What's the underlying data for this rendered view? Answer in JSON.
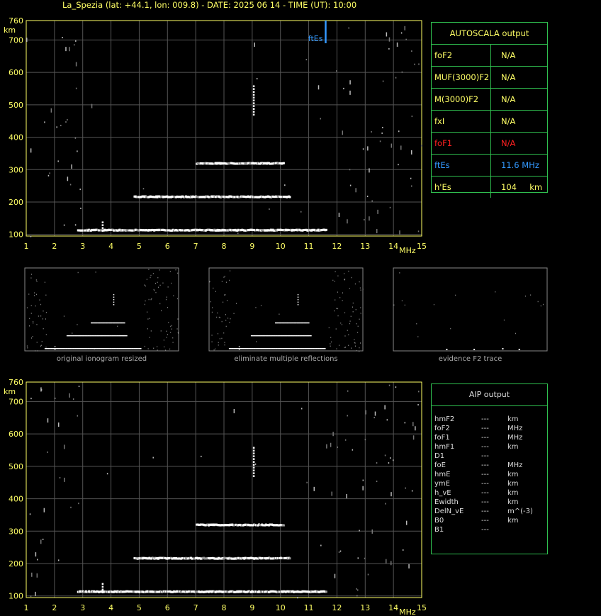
{
  "title": "La_Spezia (lat: +44.1, lon: 009.8) - DATE: 2025 06 14 - TIME (UT): 10:00",
  "colors": {
    "axis": "#ffff66",
    "grid": "#555555",
    "fEs": "#3399ff",
    "foF1": "#ff2020",
    "panel_border": "#2fbf4f"
  },
  "autoscala": {
    "header": "AUTOSCALA output",
    "rows": [
      {
        "key": "foF2",
        "value": "N/A",
        "color": "#ffff66"
      },
      {
        "key": "MUF(3000)F2",
        "value": "N/A",
        "color": "#ffff66"
      },
      {
        "key": "M(3000)F2",
        "value": "N/A",
        "color": "#ffff66"
      },
      {
        "key": "fxI",
        "value": "N/A",
        "color": "#ffff66"
      },
      {
        "key": "foF1",
        "value": "N/A",
        "color": "#ff2020"
      },
      {
        "key": "ftEs",
        "value": "11.6 MHz",
        "color": "#3399ff"
      },
      {
        "key": "h'Es",
        "value": "104     km",
        "color": "#ffff66"
      }
    ]
  },
  "aip": {
    "header": "AIP output",
    "rows": [
      {
        "name": "hmF2",
        "value": "---",
        "unit": "km"
      },
      {
        "name": "foF2",
        "value": "---",
        "unit": "MHz"
      },
      {
        "name": "foF1",
        "value": "---",
        "unit": "MHz"
      },
      {
        "name": "hmF1",
        "value": "---",
        "unit": "km"
      },
      {
        "name": "D1",
        "value": "---",
        "unit": ""
      },
      {
        "name": "foE",
        "value": "---",
        "unit": "MHz"
      },
      {
        "name": "hmE",
        "value": "---",
        "unit": "km"
      },
      {
        "name": "ymE",
        "value": "---",
        "unit": "km"
      },
      {
        "name": "h_vE",
        "value": "---",
        "unit": "km"
      },
      {
        "name": "Ewidth",
        "value": "---",
        "unit": "km"
      },
      {
        "name": "DelN_vE",
        "value": "---",
        "unit": "m^(-3)"
      },
      {
        "name": "B0",
        "value": "---",
        "unit": "km"
      },
      {
        "name": "B1",
        "value": "---",
        "unit": ""
      }
    ]
  },
  "thumbnails": {
    "captions": [
      "original ionogram resized",
      "eliminate multiple reflections",
      "evidence F2 trace"
    ]
  },
  "chart_data": [
    {
      "type": "scatter",
      "x_unit_label": "MHz",
      "y_unit_label": "km",
      "xlim": [
        1,
        15
      ],
      "ylim": [
        95,
        760
      ],
      "x_ticks": [
        1,
        2,
        3,
        4,
        5,
        6,
        7,
        8,
        9,
        10,
        11,
        12,
        13,
        14,
        15
      ],
      "y_ticks": [
        100,
        200,
        300,
        400,
        500,
        600,
        700,
        760
      ],
      "grid": true,
      "es_marker": {
        "label": "ftEs",
        "x": 11.6,
        "y_from": 690,
        "y_to": 760
      },
      "traces": [
        {
          "name": "Es trace",
          "x_from": 2.8,
          "x_to": 11.6,
          "y": 112
        },
        {
          "name": "E-region trace",
          "x_from": 4.8,
          "x_to": 10.3,
          "y": 215
        },
        {
          "name": "multiple reflection",
          "x_from": 7.0,
          "x_to": 10.1,
          "y": 318
        },
        {
          "name": "vertical spot 9.05 MHz",
          "x": 9.05,
          "y_from": 470,
          "y_to": 560
        },
        {
          "name": "spike 3.7 MHz",
          "x": 3.7,
          "y_from": 112,
          "y_to": 140
        }
      ]
    },
    {
      "type": "scatter",
      "x_unit_label": "MHz",
      "y_unit_label": "km",
      "xlim": [
        1,
        15
      ],
      "ylim": [
        95,
        760
      ],
      "x_ticks": [
        1,
        2,
        3,
        4,
        5,
        6,
        7,
        8,
        9,
        10,
        11,
        12,
        13,
        14,
        15
      ],
      "y_ticks": [
        100,
        200,
        300,
        400,
        500,
        600,
        700,
        760
      ],
      "grid": true,
      "traces": [
        {
          "name": "Es trace",
          "x_from": 2.8,
          "x_to": 11.6,
          "y": 112
        },
        {
          "name": "E-region trace",
          "x_from": 4.8,
          "x_to": 10.3,
          "y": 215
        },
        {
          "name": "multiple reflection",
          "x_from": 7.0,
          "x_to": 10.1,
          "y": 318
        },
        {
          "name": "vertical spot 9.05 MHz",
          "x": 9.05,
          "y_from": 470,
          "y_to": 560
        },
        {
          "name": "spike 3.7 MHz",
          "x": 3.7,
          "y_from": 112,
          "y_to": 140
        }
      ]
    }
  ]
}
